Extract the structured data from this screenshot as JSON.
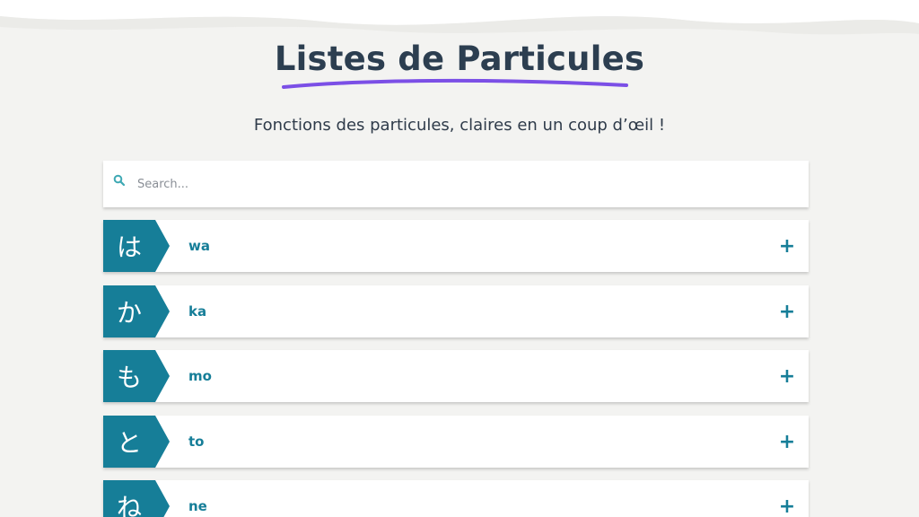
{
  "header": {
    "title": "Listes de Particules",
    "subtitle": "Fonctions des particules, claires en un coup d’œil !"
  },
  "search": {
    "placeholder": "Search...",
    "value": "",
    "icon": "search-icon"
  },
  "colors": {
    "accent": "#167e98",
    "title": "#2c3e50",
    "underline": "#7b4fe6",
    "background": "#f3f3f1"
  },
  "particles": [
    {
      "kana": "は",
      "romaji": "wa",
      "toggle": "+"
    },
    {
      "kana": "か",
      "romaji": "ka",
      "toggle": "+"
    },
    {
      "kana": "も",
      "romaji": "mo",
      "toggle": "+"
    },
    {
      "kana": "と",
      "romaji": "to",
      "toggle": "+"
    },
    {
      "kana": "ね",
      "romaji": "ne",
      "toggle": "+"
    }
  ]
}
